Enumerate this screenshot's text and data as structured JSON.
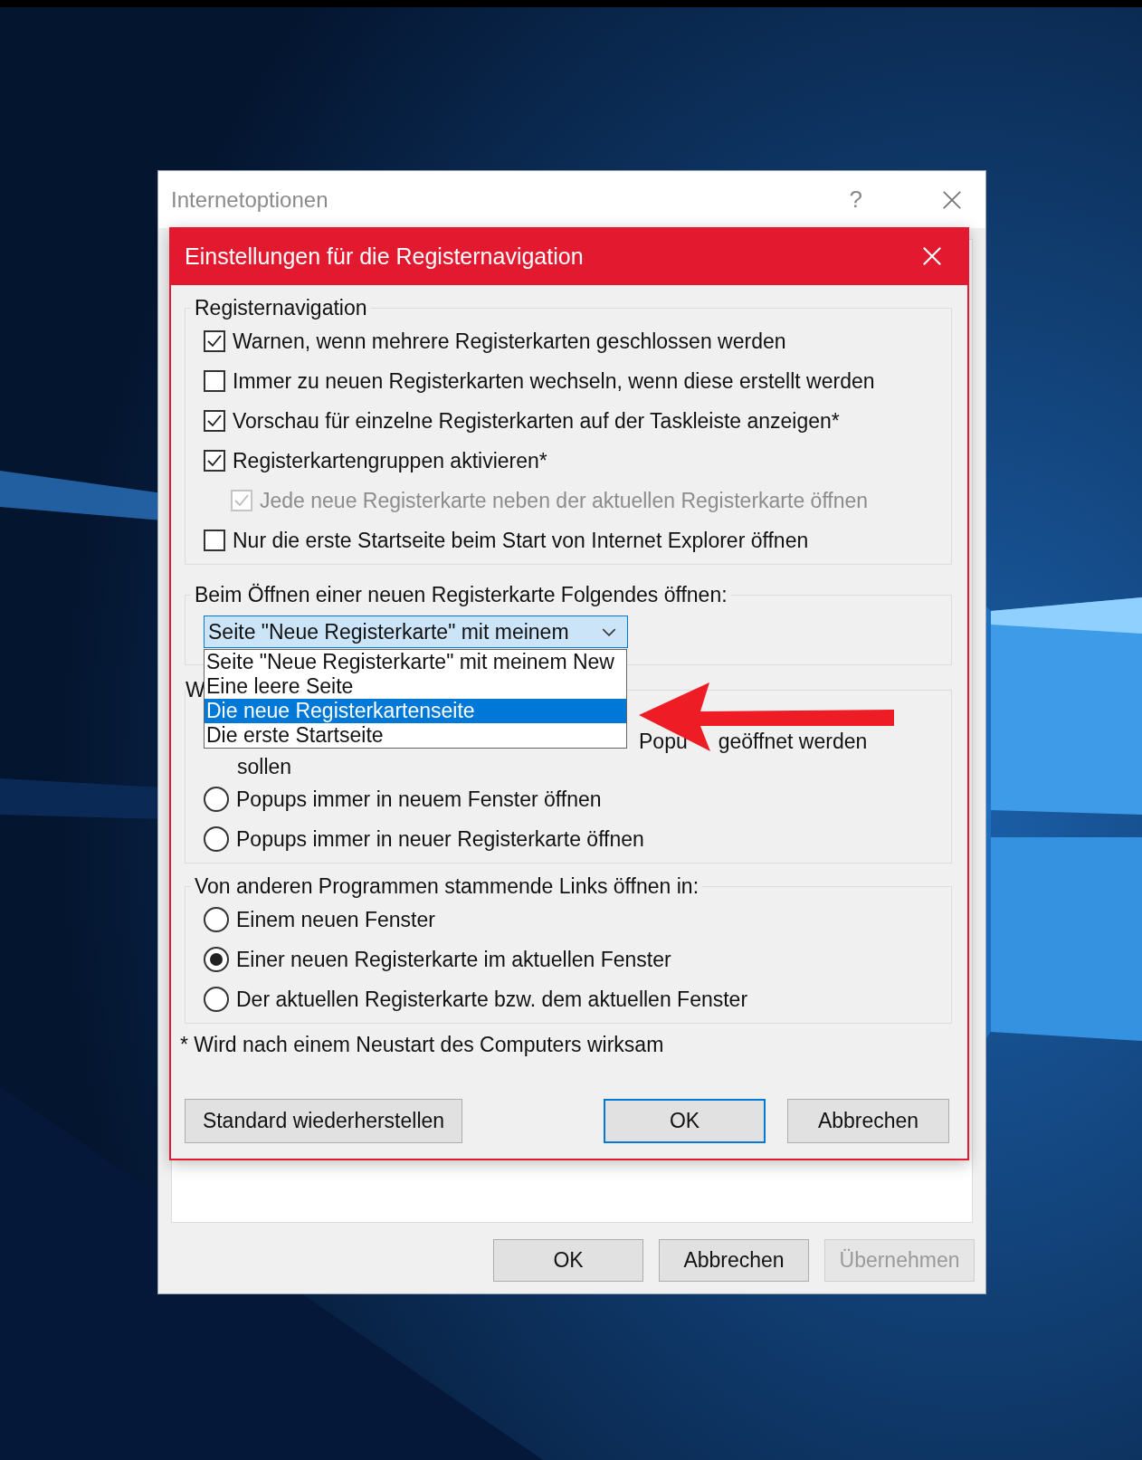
{
  "window": {
    "title": "Internetoptionen",
    "help": "?",
    "buttons": [
      {
        "label": "OK",
        "disabled": false
      },
      {
        "label": "Abbrechen",
        "disabled": false
      },
      {
        "label": "Übernehmen",
        "disabled": true
      }
    ]
  },
  "dialog": {
    "title": "Einstellungen für die Registernavigation",
    "tab_group": {
      "label": "Registernavigation",
      "items": [
        {
          "label": "Warnen, wenn mehrere Registerkarten geschlossen werden",
          "checked": true,
          "disabled": false
        },
        {
          "label": "Immer zu neuen Registerkarten wechseln, wenn diese erstellt werden",
          "checked": false,
          "disabled": false
        },
        {
          "label": "Vorschau für einzelne Registerkarten auf der Taskleiste anzeigen*",
          "checked": true,
          "disabled": false
        },
        {
          "label": "Registerkartengruppen aktivieren*",
          "checked": true,
          "disabled": false,
          "children": [
            {
              "label": "Jede neue Registerkarte neben der aktuellen Registerkarte öffnen",
              "checked": true,
              "disabled": true
            }
          ]
        },
        {
          "label": "Nur die erste Startseite beim Start von Internet Explorer öffnen",
          "checked": false,
          "disabled": false
        }
      ]
    },
    "new_tab_group": {
      "label": "Beim Öffnen einer neuen Registerkarte Folgendes öffnen:",
      "combo": {
        "value": "Seite \"Neue Registerkarte\" mit meinem",
        "expanded": true,
        "options": [
          {
            "label": "Seite \"Neue Registerkarte\" mit meinem New",
            "selected": false
          },
          {
            "label": "Eine leere Seite",
            "selected": false
          },
          {
            "label": "Die neue Registerkartenseite",
            "selected": true
          },
          {
            "label": "Die erste Startseite",
            "selected": false
          }
        ]
      }
    },
    "popup_group": {
      "label": "W",
      "covered_option_text": [
        [
          "Popu",
          "geöffnet werden"
        ],
        "sollen"
      ],
      "options": [
        {
          "label": "Popups immer in neuem Fenster öffnen",
          "selected": false
        },
        {
          "label": "Popups immer in neuer Registerkarte öffnen",
          "selected": false
        }
      ]
    },
    "links_group": {
      "label": "Von anderen Programmen stammende Links öffnen in:",
      "options": [
        {
          "label": "Einem neuen Fenster",
          "selected": false
        },
        {
          "label": "Einer neuen Registerkarte im aktuellen Fenster",
          "selected": true
        },
        {
          "label": "Der aktuellen Registerkarte bzw. dem aktuellen Fenster",
          "selected": false
        }
      ]
    },
    "footnote": "* Wird nach einem Neustart des Computers wirksam",
    "buttons": [
      {
        "label": "Standard wiederherstellen",
        "default": false
      },
      {
        "label": "OK",
        "default": true
      },
      {
        "label": "Abbrechen",
        "default": false
      }
    ]
  }
}
